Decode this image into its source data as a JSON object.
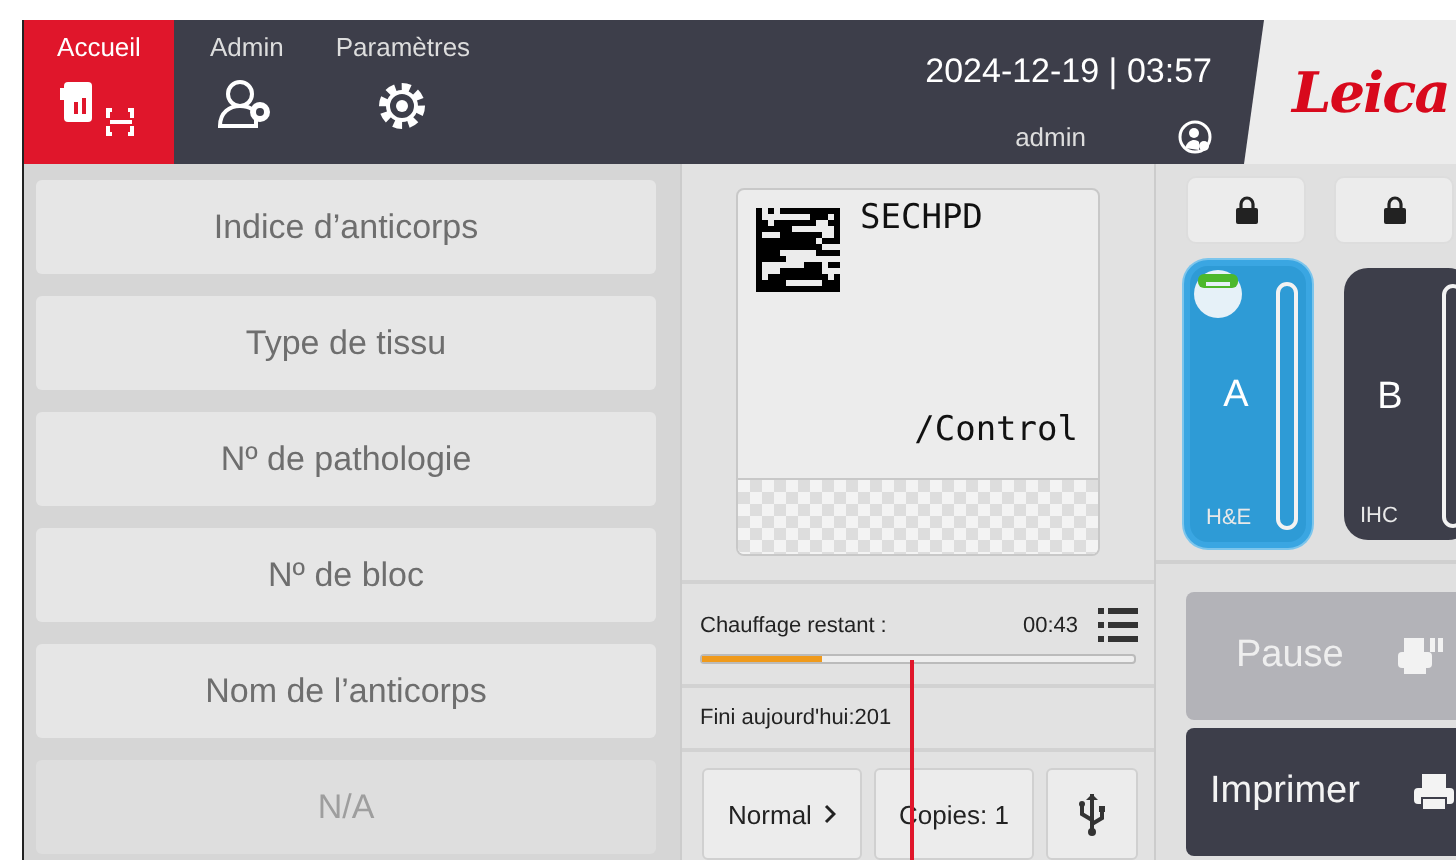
{
  "tabs": [
    {
      "label": "Accueil",
      "kind": "home",
      "selected": true
    },
    {
      "label": "Admin",
      "kind": "admin",
      "selected": false
    },
    {
      "label": "Paramètres",
      "kind": "settings",
      "selected": false
    }
  ],
  "datetime": "2024-12-19 | 03:57",
  "user": "admin",
  "logo": "Leica",
  "fields": [
    {
      "label": "Indice d’anticorps",
      "disabled": false
    },
    {
      "label": "Type de tissu",
      "disabled": false
    },
    {
      "label": "Nº de pathologie",
      "disabled": false
    },
    {
      "label": "Nº de bloc",
      "disabled": false
    },
    {
      "label": "Nom de l’anticorps",
      "disabled": false
    },
    {
      "label": "N/A",
      "disabled": true
    }
  ],
  "label_preview": {
    "top_text": "SECHPD",
    "bottom_text": "/Control"
  },
  "heating": {
    "label": "Chauffage restant :",
    "time": "00:43",
    "level": 0.28
  },
  "finished": "Fini aujourd'hui:201",
  "mode_button": "Normal",
  "copies_button": "Copies: 1",
  "trays": [
    {
      "letter": "A",
      "type": "H&E",
      "selected": true,
      "locked": true,
      "indicator": true
    },
    {
      "letter": "B",
      "type": "IHC",
      "selected": false,
      "locked": true,
      "indicator": false
    }
  ],
  "actions": [
    {
      "label": "Pause",
      "kind": "pause",
      "disabled": true
    },
    {
      "label": "Imprimer",
      "kind": "print",
      "disabled": false
    }
  ]
}
